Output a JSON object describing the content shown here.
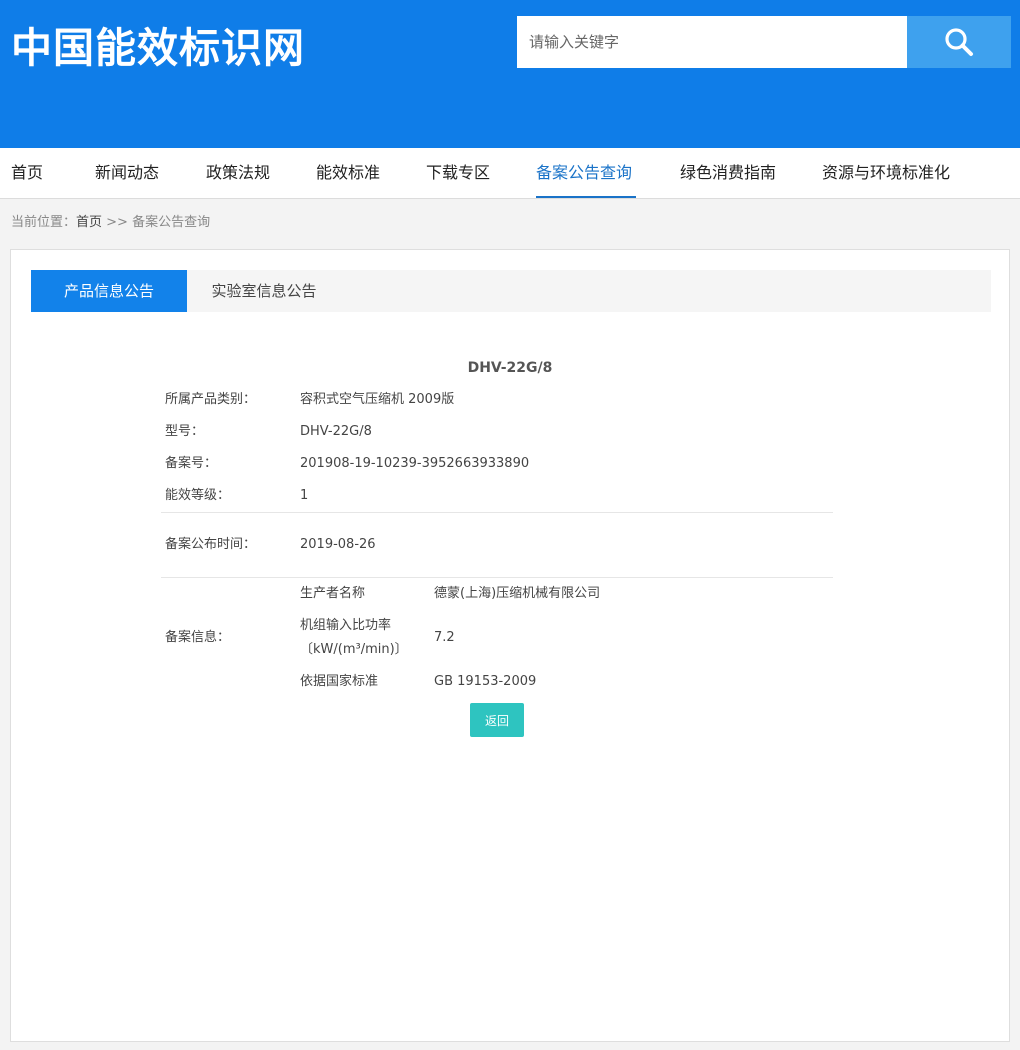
{
  "header": {
    "logo_text": "中国能效标识网",
    "search_placeholder": "请输入关键字"
  },
  "nav": {
    "items": [
      {
        "label": "首页"
      },
      {
        "label": "新闻动态"
      },
      {
        "label": "政策法规"
      },
      {
        "label": "能效标准"
      },
      {
        "label": "下载专区"
      },
      {
        "label": "备案公告查询",
        "active": true
      },
      {
        "label": "绿色消费指南"
      },
      {
        "label": "资源与环境标准化"
      }
    ]
  },
  "breadcrumb": {
    "prefix": "当前位置：",
    "home": "首页",
    "separator": " >> ",
    "current": "备案公告查询"
  },
  "tabs": [
    {
      "label": "产品信息公告",
      "active": true
    },
    {
      "label": "实验室信息公告",
      "active": false
    }
  ],
  "product": {
    "model_title": "DHV-22G/8",
    "fields": [
      {
        "label": "所属产品类别：",
        "value": "容积式空气压缩机 2009版"
      },
      {
        "label": "型号：",
        "value": "DHV-22G/8"
      },
      {
        "label": "备案号：",
        "value": "201908-19-10239-3952663933890"
      },
      {
        "label": "能效等级：",
        "value": "1"
      }
    ],
    "publish": {
      "label": "备案公布时间：",
      "value": "2019-08-26"
    },
    "record_info": {
      "label": "备案信息：",
      "rows": [
        {
          "label": "生产者名称",
          "value": "德蒙(上海)压缩机械有限公司"
        },
        {
          "label": "机组输入比功率",
          "label2": "〔kW/(m³/min)〕",
          "value": "7.2"
        },
        {
          "label": "依据国家标准",
          "value": "GB 19153-2009"
        }
      ]
    },
    "back_label": "返回"
  },
  "colors": {
    "header_blue": "#0f7de8",
    "search_button": "#3ea1ee",
    "active_tab": "#1282ea",
    "nav_active": "#1a73c8",
    "back_button": "#2ec4c0"
  }
}
